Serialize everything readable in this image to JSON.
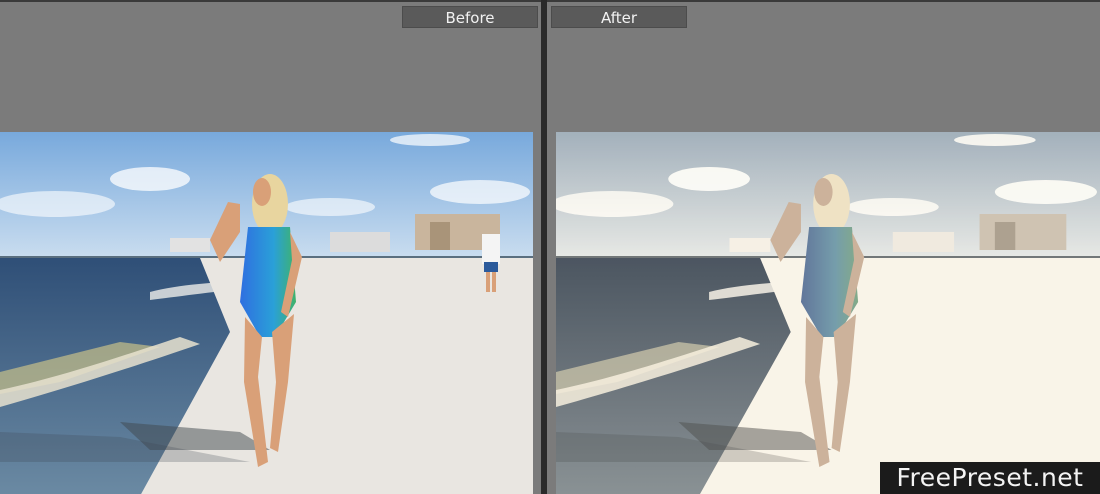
{
  "panes": {
    "before": {
      "label": "Before"
    },
    "after": {
      "label": "After"
    }
  },
  "watermark": {
    "text": "FreePreset.net"
  },
  "photo": {
    "subject": "woman in swimsuit walking on beach",
    "palette": {
      "sky": "#9cc3ea",
      "sea": "#3f5f86",
      "sand": "#ece8e1",
      "swimsuit_blue": "#2f7fdc",
      "swimsuit_green": "#49b36e",
      "skin": "#d9a078"
    }
  }
}
